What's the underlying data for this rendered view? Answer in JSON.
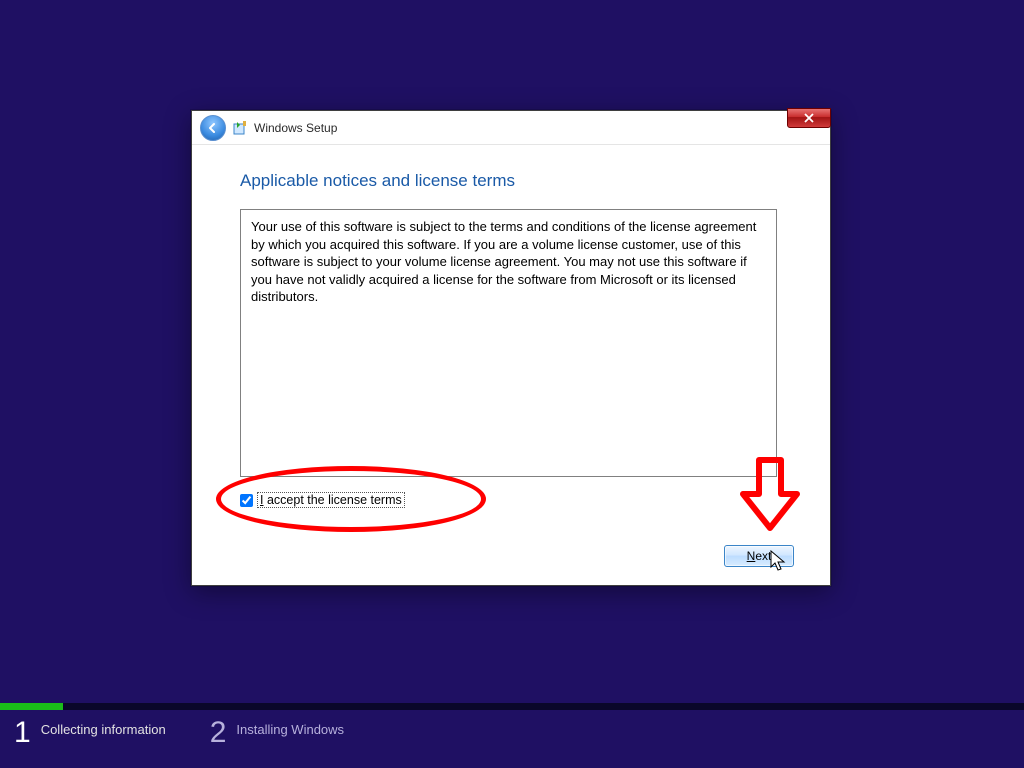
{
  "window": {
    "title": "Windows Setup"
  },
  "dialog": {
    "heading": "Applicable notices and license terms",
    "license_text": "Your use of this software is subject to the terms and conditions of the license agreement by which you acquired this software.  If you are a volume license customer, use of this software is subject to your volume license agreement.  You may not use this software if you have not validly acquired a license for the software from Microsoft or its licensed distributors.",
    "accept_label_full": "I accept the license terms",
    "accept_checked": true,
    "next_label": "Next"
  },
  "progress": {
    "fill_percent": 6.2,
    "steps": [
      {
        "num": "1",
        "label": "Collecting information",
        "active": true
      },
      {
        "num": "2",
        "label": "Installing Windows",
        "active": false
      }
    ]
  },
  "annotations": {
    "ellipse_highlight": "accept-checkbox",
    "arrow_target": "next-button"
  }
}
